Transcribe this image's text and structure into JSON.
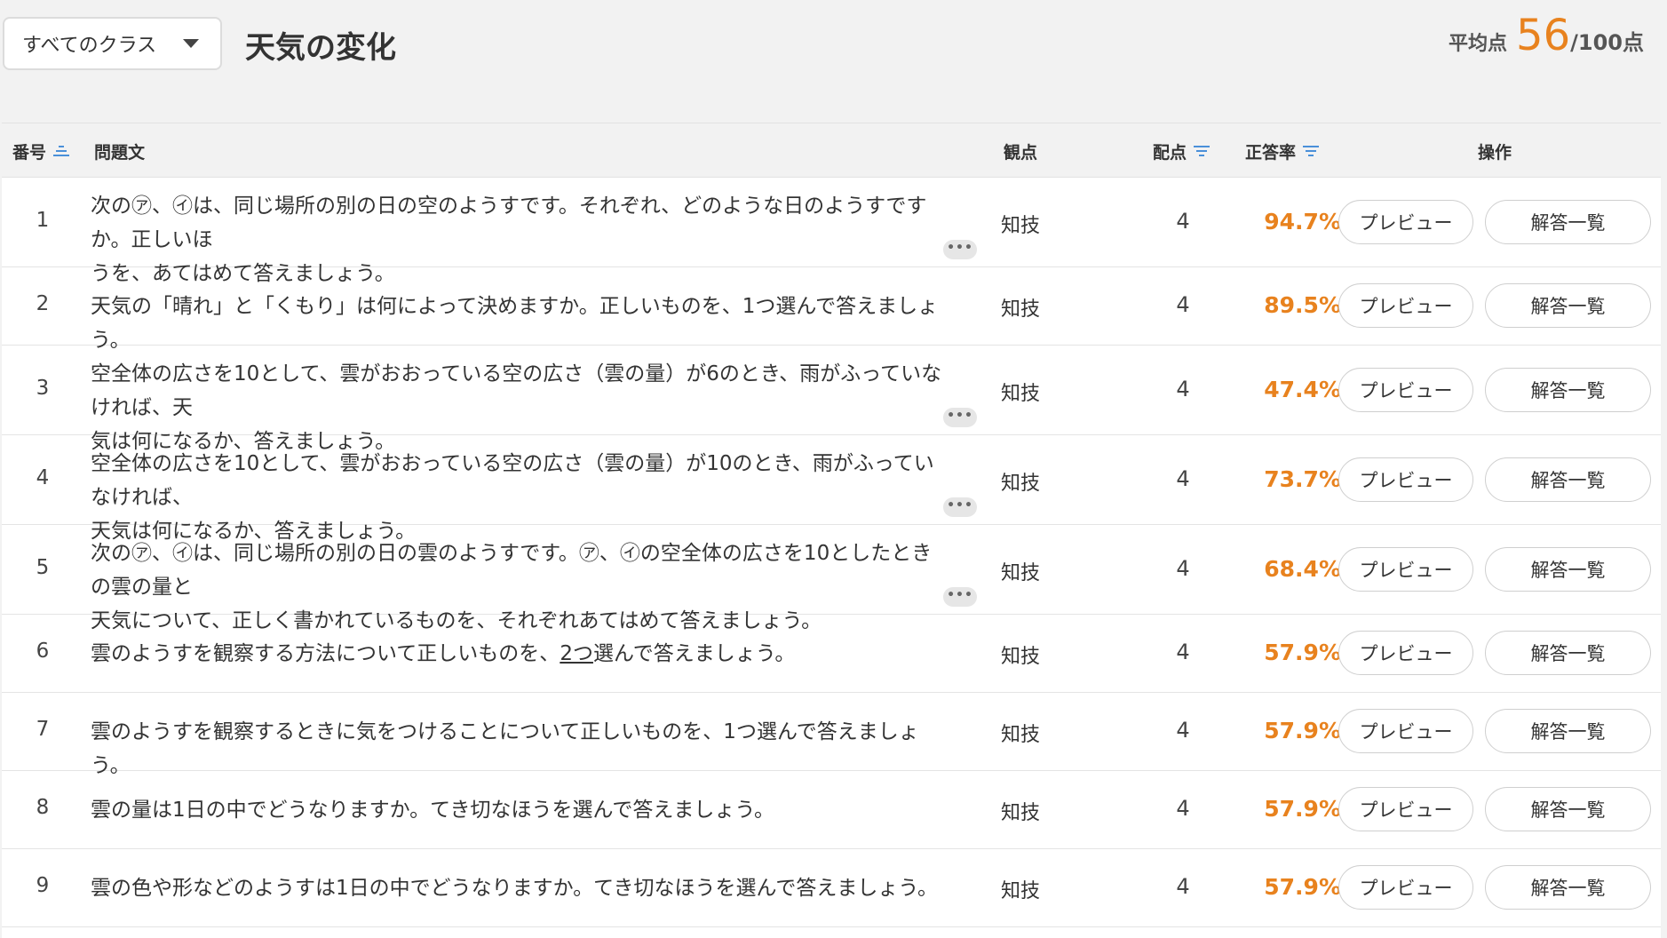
{
  "header": {
    "class_select": "すべてのクラス",
    "title": "天気の変化",
    "avg_label": "平均点",
    "avg_value": "56",
    "avg_total": "/100点"
  },
  "columns": {
    "number": "番号",
    "question": "問題文",
    "viewpoint": "観点",
    "points": "配点",
    "rate": "正答率",
    "actions": "操作"
  },
  "buttons": {
    "preview": "プレビュー",
    "answers": "解答一覧"
  },
  "more_label": "•••",
  "rows": [
    {
      "num": "1",
      "lines": [
        "次の㋐、㋑は、同じ場所の別の日の空のようすです。それぞれ、どのような日のようすですか。正しいほ",
        "うを、あてはめて答えましょう。"
      ],
      "view": "知技",
      "points": "4",
      "rate": "94.7%"
    },
    {
      "num": "2",
      "lines": [
        "天気の「晴れ」と「くもり」は何によって決めますか。正しいものを、1つ選んで答えましょう。"
      ],
      "view": "知技",
      "points": "4",
      "rate": "89.5%"
    },
    {
      "num": "3",
      "lines": [
        "空全体の広さを10として、雲がおおっている空の広さ（雲の量）が6のとき、雨がふっていなければ、天",
        "気は何になるか、答えましょう。"
      ],
      "view": "知技",
      "points": "4",
      "rate": "47.4%"
    },
    {
      "num": "4",
      "lines": [
        "空全体の広さを10として、雲がおおっている空の広さ（雲の量）が10のとき、雨がふっていなければ、",
        "天気は何になるか、答えましょう。"
      ],
      "view": "知技",
      "points": "4",
      "rate": "73.7%"
    },
    {
      "num": "5",
      "lines": [
        "次の㋐、㋑は、同じ場所の別の日の雲のようすです。㋐、㋑の空全体の広さを10としたときの雲の量と",
        "天気について、正しく書かれているものを、それぞれあてはめて答えましょう。"
      ],
      "view": "知技",
      "points": "4",
      "rate": "68.4%"
    },
    {
      "num": "6",
      "pre": "雲のようすを観察する方法について正しいものを、",
      "underline": "2つ",
      "post": "選んで答えましょう。",
      "view": "知技",
      "points": "4",
      "rate": "57.9%"
    },
    {
      "num": "7",
      "lines": [
        "雲のようすを観察するときに気をつけることについて正しいものを、1つ選んで答えましょう。"
      ],
      "view": "知技",
      "points": "4",
      "rate": "57.9%"
    },
    {
      "num": "8",
      "lines": [
        "雲の量は1日の中でどうなりますか。てき切なほうを選んで答えましょう。"
      ],
      "view": "知技",
      "points": "4",
      "rate": "57.9%"
    },
    {
      "num": "9",
      "lines": [
        "雲の色や形などのようすは1日の中でどうなりますか。てき切なほうを選んで答えましょう。"
      ],
      "view": "知技",
      "points": "4",
      "rate": "57.9%"
    }
  ]
}
